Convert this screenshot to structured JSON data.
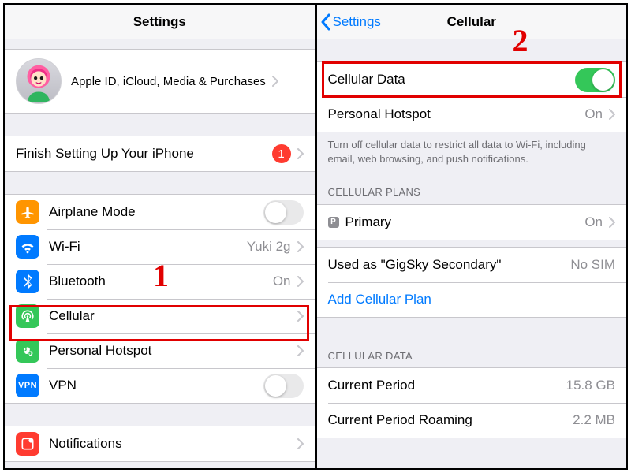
{
  "left": {
    "title": "Settings",
    "apple_id_text": "Apple ID, iCloud, Media & Purchases",
    "finish_setup": "Finish Setting Up Your iPhone",
    "finish_badge": "1",
    "airplane": "Airplane Mode",
    "wifi": "Wi-Fi",
    "wifi_value": "Yuki 2g",
    "bluetooth": "Bluetooth",
    "bluetooth_value": "On",
    "cellular": "Cellular",
    "hotspot": "Personal Hotspot",
    "vpn": "VPN",
    "notifications": "Notifications"
  },
  "right": {
    "back": "Settings",
    "title": "Cellular",
    "cellular_data": "Cellular Data",
    "hotspot": "Personal Hotspot",
    "hotspot_value": "On",
    "data_footer": "Turn off cellular data to restrict all data to Wi-Fi, including email, web browsing, and push notifications.",
    "plans_header": "Cellular Plans",
    "primary": "Primary",
    "primary_value": "On",
    "used_as": "Used as \"GigSky Secondary\"",
    "used_as_value": "No SIM",
    "add_plan": "Add Cellular Plan",
    "data_header": "Cellular Data",
    "current_period": "Current Period",
    "current_period_value": "15.8 GB",
    "roaming": "Current Period Roaming",
    "roaming_value": "2.2 MB",
    "p_badge": "P"
  },
  "annotations": {
    "n1": "1",
    "n2": "2"
  }
}
